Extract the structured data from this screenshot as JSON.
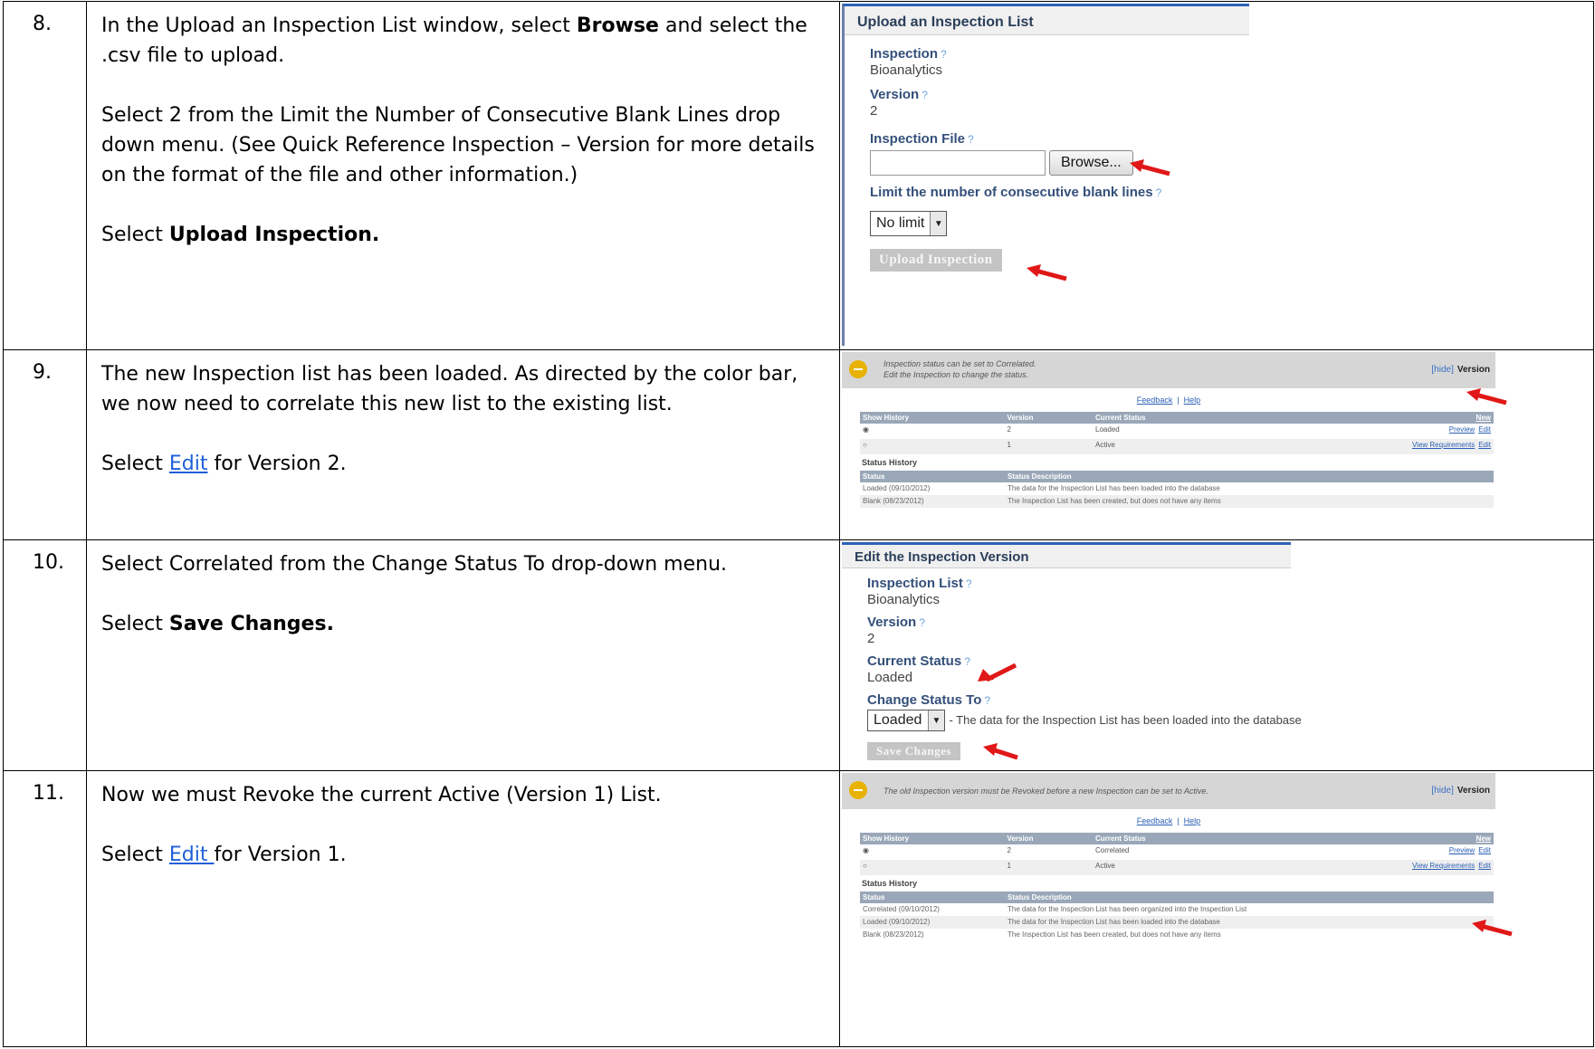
{
  "rows": [
    {
      "number": "8.",
      "paragraphs": [
        [
          "In the Upload an Inspection List window, select ",
          "Browse",
          " and select the .csv file to upload."
        ],
        [
          "Select 2 from the Limit the Number of Consecutive Blank Lines drop down menu.  (See Quick Reference Inspection – Version for more details on the format of the file and other information.)"
        ],
        [
          "Select ",
          "Upload Inspection."
        ]
      ]
    },
    {
      "number": "9.",
      "text1": "The new Inspection list has been loaded.  As directed by the color bar, we now need to correlate this new list to the existing list.",
      "text2_pre": "Select ",
      "text2_link": "Edit",
      "text2_post": " for Version 2."
    },
    {
      "number": "10.",
      "text1": "Select Correlated from the Change Status To drop-down menu.",
      "text2_pre": "Select ",
      "text2_bold": "Save Changes."
    },
    {
      "number": "11.",
      "text1": "Now we must Revoke the current Active (Version 1) List.",
      "text2_pre": "Select ",
      "text2_link": "Edit ",
      "text2_post": "for Version 1."
    }
  ],
  "upload_window": {
    "title": "Upload an Inspection List",
    "inspection_label": "Inspection",
    "inspection_value": "Bioanalytics",
    "version_label": "Version",
    "version_value": "2",
    "file_label": "Inspection File",
    "browse": "Browse...",
    "limit_label": "Limit the number of consecutive blank lines",
    "limit_value": "No limit",
    "upload_button": "Upload Inspection",
    "help": "?"
  },
  "status1": {
    "message1": "Inspection status can be set to Correlated.",
    "message2": "Edit the Inspection to change the status.",
    "hide": "[hide]",
    "version": "Version",
    "feedback": "Feedback",
    "help": "Help",
    "headers": [
      "Show History",
      "Version",
      "Current Status",
      "New"
    ],
    "rows": [
      {
        "version": "2",
        "status": "Loaded",
        "link1": "Preview",
        "link2": "Edit"
      },
      {
        "version": "1",
        "status": "Active",
        "link1": "View Requirements",
        "link2": "Edit"
      }
    ],
    "history_label": "Status History",
    "history_headers": [
      "Status",
      "Status Description"
    ],
    "history": [
      {
        "status": "Loaded (09/10/2012)",
        "desc": "The data for the Inspection List has been loaded into the database"
      },
      {
        "status": "Blank (08/23/2012)",
        "desc": "The Inspection List has been created, but does not have any items"
      }
    ]
  },
  "edit_window": {
    "title": "Edit the Inspection Version",
    "list_label": "Inspection List",
    "list_value": "Bioanalytics",
    "version_label": "Version",
    "version_value": "2",
    "current_label": "Current Status",
    "current_value": "Loaded",
    "change_label": "Change Status To",
    "change_value": "Loaded",
    "change_desc": "- The data for the Inspection List has been loaded into the database",
    "save_button": "Save Changes"
  },
  "status2": {
    "message1": "The old Inspection version must be Revoked before a new Inspection can be set to Active.",
    "hide": "[hide]",
    "version": "Version",
    "feedback": "Feedback",
    "help": "Help",
    "headers": [
      "Show History",
      "Version",
      "Current Status",
      "New"
    ],
    "rows": [
      {
        "version": "2",
        "status": "Correlated",
        "link1": "Preview",
        "link2": "Edit"
      },
      {
        "version": "1",
        "status": "Active",
        "link1": "View Requirements",
        "link2": "Edit"
      }
    ],
    "history_label": "Status History",
    "history_headers": [
      "Status",
      "Status Description"
    ],
    "history": [
      {
        "status": "Correlated (09/10/2012)",
        "desc": "The data for the Inspection List has been organized into the Inspection List"
      },
      {
        "status": "Loaded (09/10/2012)",
        "desc": "The data for the Inspection List has been loaded into the database"
      },
      {
        "status": "Blank (08/23/2012)",
        "desc": "The Inspection List has been created, but does not have any items"
      }
    ]
  },
  "colors": {
    "arrow": "#e01818",
    "link": "#1f5fd8",
    "status_dot": "#e8b200",
    "table_header": "#9aa7b8"
  }
}
